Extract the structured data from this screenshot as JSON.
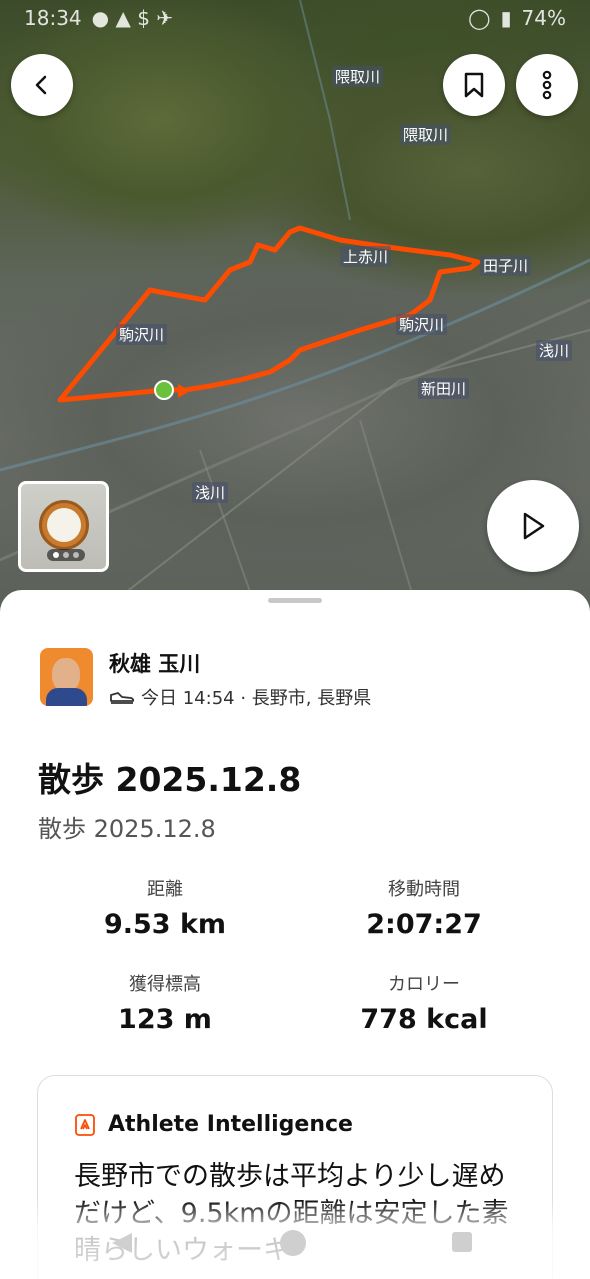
{
  "status_bar": {
    "time": "18:34",
    "battery": "74%"
  },
  "map": {
    "labels": [
      "隈取川",
      "隈取川",
      "田子川",
      "浅川",
      "新田川",
      "浅川",
      "駒沢川",
      "駒沢川",
      "上赤川"
    ],
    "route_color": "#fc4c02",
    "start_color": "#6ac13b"
  },
  "header": {
    "back_icon": "chevron-left-icon",
    "bookmark_icon": "bookmark-icon",
    "more_icon": "more-vertical-icon"
  },
  "photo": {
    "count_dots": 3
  },
  "athlete": {
    "name": "秋雄 玉川",
    "activity_meta": "今日 14:54 · 長野市, 長野県"
  },
  "activity": {
    "title": "散歩 2025.12.8",
    "description": "散歩 2025.12.8"
  },
  "stats": {
    "distance_label": "距離",
    "distance_value": "9.53 km",
    "moving_time_label": "移動時間",
    "moving_time_value": "2:07:27",
    "elevation_label": "獲得標高",
    "elevation_value": "123 m",
    "calories_label": "カロリー",
    "calories_value": "778 kcal"
  },
  "ai_card": {
    "title": "Athlete Intelligence",
    "text": "長野市での散歩は平均より少し遅めだけど、9.5kmの距離は安定した素晴らしいウォーキ"
  }
}
